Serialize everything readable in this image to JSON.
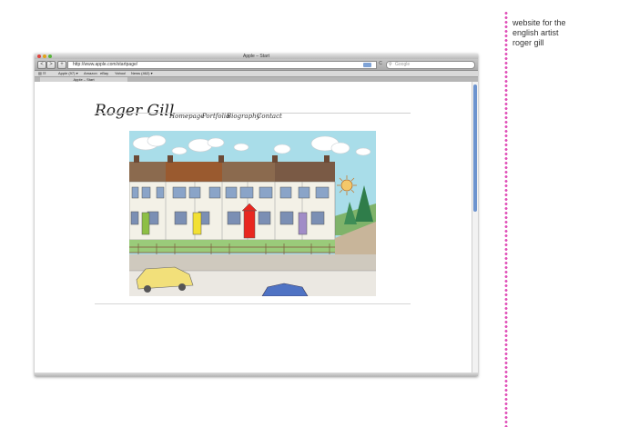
{
  "browser": {
    "window_title": "Apple – Start",
    "url": "http://www.apple.com/startpage/",
    "search_placeholder": "Google",
    "reload_symbol": "C",
    "bookmarks": [
      "Apple (97) ▾",
      "Amazon",
      "eBay",
      "Yahoo!",
      "News (462) ▾"
    ],
    "tab_label": "Apple – Start",
    "back_symbol": "<",
    "forward_symbol": ">",
    "add_symbol": "+"
  },
  "site": {
    "logo": "Roger Gill",
    "nav": [
      "Homepage",
      "Portfolio",
      "Biography",
      "Contact"
    ]
  },
  "caption": {
    "line1": "website for the",
    "line2": "english artist",
    "line3": "roger gill"
  },
  "colors": {
    "sky": "#a9dde9",
    "roof": "#8b6a4e",
    "door_red": "#e8271f",
    "door_green": "#8dbf44",
    "door_yellow": "#f2e033",
    "door_purple": "#a18cc7",
    "car_yellow": "#f2e07a",
    "car_blue": "#4f73c4",
    "scroll_thumb": "#6d94cf",
    "star_pink": "#e04fb8"
  },
  "icons": [
    "close-icon",
    "minimize-icon",
    "zoom-icon",
    "rss-icon",
    "search-icon",
    "sun-icon"
  ]
}
